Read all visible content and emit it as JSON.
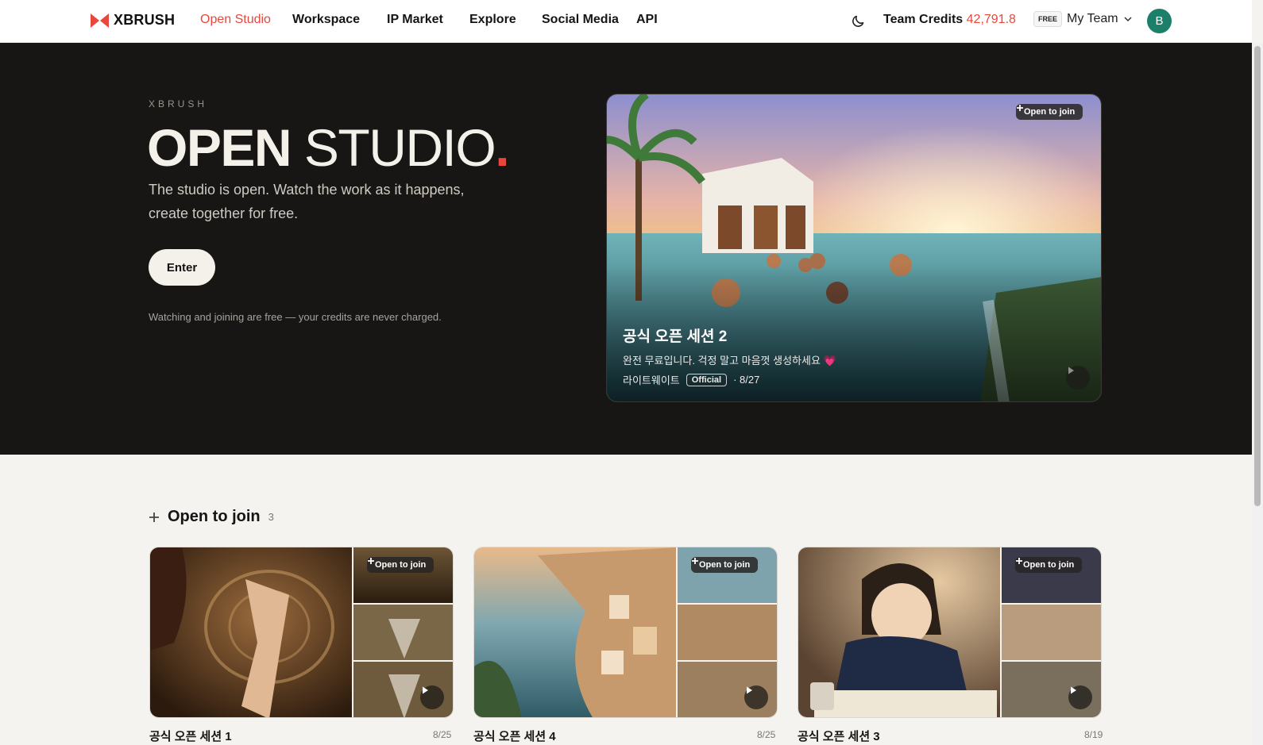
{
  "nav": {
    "logo": "XBRUSH",
    "links": [
      "Open Studio",
      "Workspace",
      "IP Market",
      "Explore",
      "Social Media",
      "API"
    ],
    "credits_label": "Team Credits",
    "credits_value": "42,791.8",
    "plan_badge": "FREE",
    "team_name": "My Team",
    "avatar_initial": "B"
  },
  "hero": {
    "eyebrow": "XBRUSH",
    "title_bold": "OPEN",
    "title_light": "STUDIO",
    "title_dot": ".",
    "subtitle": "The studio is open. Watch the work as it happens, create together for free.",
    "enter_label": "Enter",
    "note": "Watching and joining are free — your credits are never charged."
  },
  "feature": {
    "badge": "Open to join",
    "title": "공식 오픈 세션 2",
    "description": "완전 무료입니다. 걱정 말고 마음껏 생성하세요 💗",
    "author": "라이트웨이트",
    "tag": "Official",
    "count": "· 8/27"
  },
  "section": {
    "title": "Open to join",
    "count": "3",
    "cards": [
      {
        "title": "공식 오픈 세션 1",
        "count": "8/25",
        "badge": "Open to join"
      },
      {
        "title": "공식 오픈 세션 4",
        "count": "8/25",
        "badge": "Open to join"
      },
      {
        "title": "공식 오픈 세션 3",
        "count": "8/19",
        "badge": "Open to join"
      }
    ]
  },
  "colors": {
    "accent": "#e8473d",
    "hero_bg": "#171615",
    "page_bg": "#f4f3ef",
    "avatar": "#1b7f6a"
  },
  "icons": [
    "xbrush-logo-icon",
    "moon-icon",
    "chevron-down-icon",
    "plus-icon",
    "play-icon"
  ]
}
